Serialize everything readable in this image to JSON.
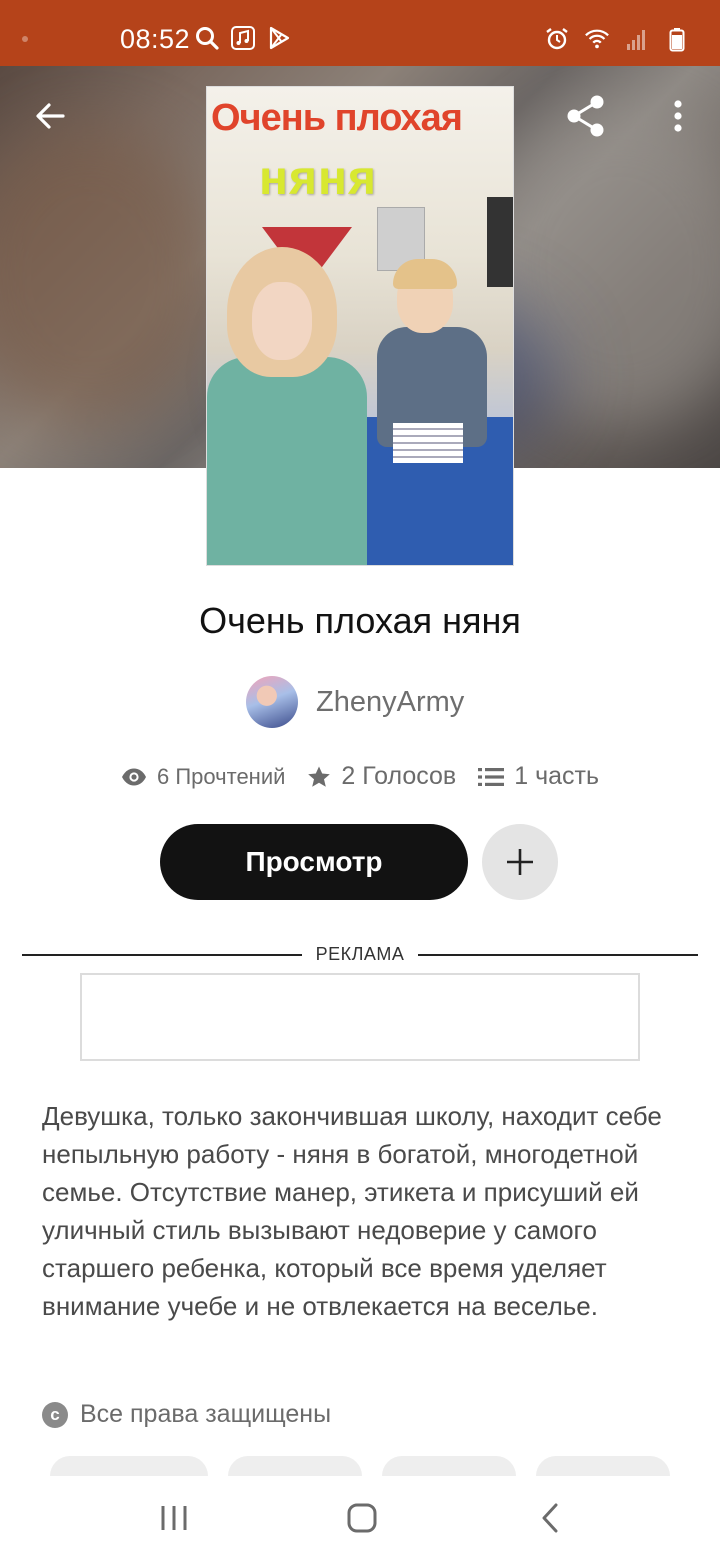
{
  "status_bar": {
    "time": "08:52",
    "left_icons": [
      "search-icon",
      "music-icon",
      "play-store-icon"
    ],
    "right_icons": [
      "alarm-icon",
      "wifi-icon",
      "signal-icon",
      "battery-icon"
    ],
    "color": "#b5431a"
  },
  "header": {
    "back_icon": "arrow-left-icon",
    "share_icon": "share-icon",
    "more_icon": "more-vertical-icon"
  },
  "cover": {
    "title_line1": "Очень плохая",
    "title_line2": "няня"
  },
  "book": {
    "title": "Очень плохая няня",
    "author": "ZhenyArmy"
  },
  "stats": {
    "reads": "6 Прочтений",
    "votes": "2 Голосов",
    "parts": "1 часть"
  },
  "actions": {
    "read_label": "Просмотр",
    "add_icon": "plus-icon"
  },
  "ad": {
    "label": "РЕКЛАМА"
  },
  "description": "Девушка, только закончившая школу, находит себе непыльную работу - няня в богатой, многодетной семье. Отсутствие манер, этикета и присуший ей уличный стиль вызывают недоверие у самого старшего ребенка, который все время уделяет внимание учебе и не отвлекается на веселье.",
  "copyright": {
    "icon": "copyright-icon",
    "text": "Все права защищены"
  },
  "nav_bar": {
    "recent_icon": "recent-apps-icon",
    "home_icon": "home-icon",
    "back_icon": "nav-back-icon"
  }
}
